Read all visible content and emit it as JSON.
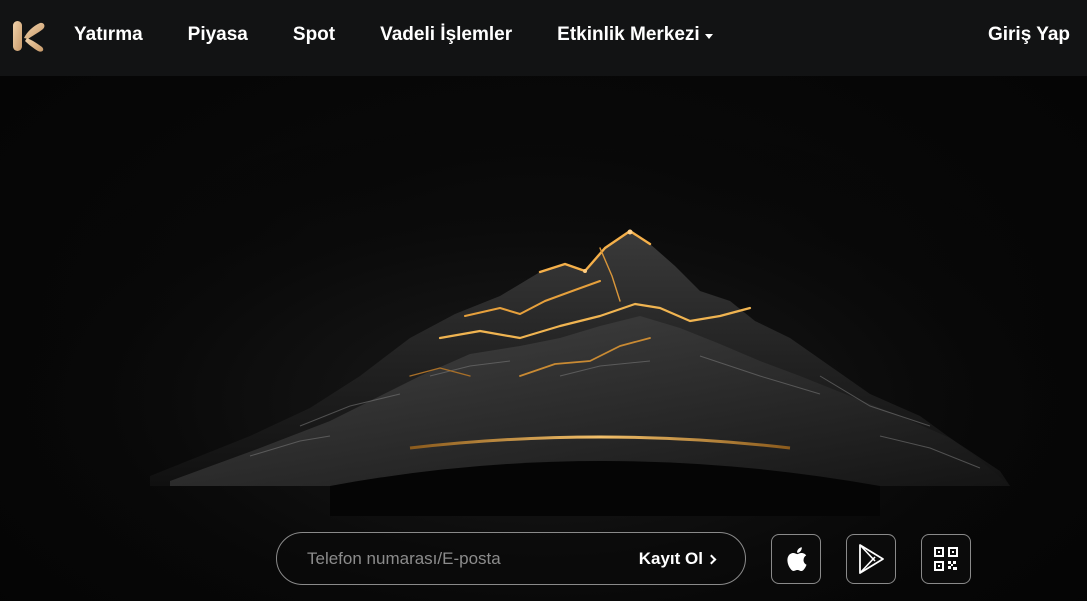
{
  "brand": {
    "logo_icon": "k-logo-icon",
    "accent_color": "#e0b88a"
  },
  "nav": {
    "items": [
      {
        "label": "Yatırma"
      },
      {
        "label": "Piyasa"
      },
      {
        "label": "Spot"
      },
      {
        "label": "Vadeli İşlemler"
      },
      {
        "label": "Etkinlik Merkezi",
        "has_dropdown": true
      }
    ],
    "login_label": "Giriş Yap"
  },
  "hero": {
    "background_icon": "mountain-illustration",
    "glow_color": "#e9a13b"
  },
  "signup": {
    "placeholder": "Telefon numarası/E-posta",
    "value": "",
    "button_label": "Kayıt Ol"
  },
  "app_buttons": [
    {
      "icon": "apple-icon"
    },
    {
      "icon": "google-play-icon"
    },
    {
      "icon": "qr-code-icon"
    }
  ]
}
